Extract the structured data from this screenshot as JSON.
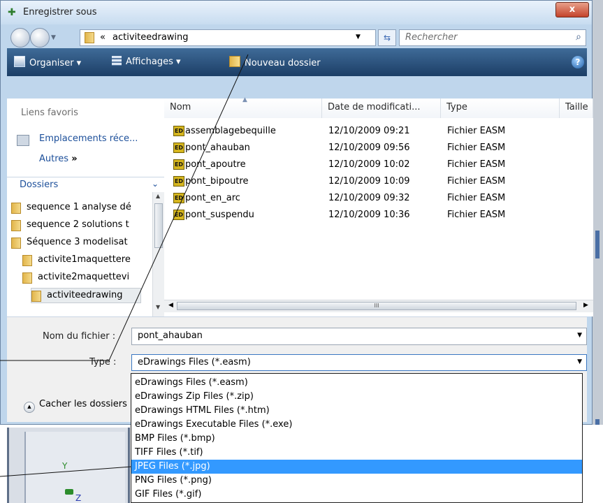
{
  "window": {
    "title": "Enregistrer sous",
    "close_label": "x"
  },
  "nav": {
    "breadcrumb_prefix": "«",
    "path": "activiteedrawing",
    "search_placeholder": "Rechercher"
  },
  "toolbar": {
    "organize": "Organiser",
    "views": "Affichages",
    "new_folder": "Nouveau dossier",
    "help": "?"
  },
  "sidebar": {
    "favorites_header": "Liens favoris",
    "recent_places": "Emplacements réce...",
    "others": "Autres",
    "others_chevron": "»",
    "folders_header": "Dossiers",
    "tree": [
      "sequence 1 analyse dé",
      "sequence 2 solutions t",
      "Séquence 3 modelisat",
      "activite1maquettere",
      "activite2maquettevi",
      "activiteedrawing"
    ]
  },
  "file_list": {
    "columns": [
      "Nom",
      "Date de modificati...",
      "Type",
      "Taille"
    ],
    "rows": [
      {
        "name": "assemblagebequille",
        "date": "12/10/2009 09:21",
        "type": "Fichier EASM"
      },
      {
        "name": "pont_ahauban",
        "date": "12/10/2009 09:56",
        "type": "Fichier EASM"
      },
      {
        "name": "pont_apoutre",
        "date": "12/10/2009 10:02",
        "type": "Fichier EASM"
      },
      {
        "name": "pont_bipoutre",
        "date": "12/10/2009 10:09",
        "type": "Fichier EASM"
      },
      {
        "name": "pont_en_arc",
        "date": "12/10/2009 09:32",
        "type": "Fichier EASM"
      },
      {
        "name": "pont_suspendu",
        "date": "12/10/2009 10:36",
        "type": "Fichier EASM"
      }
    ],
    "hscroll_grip": "III"
  },
  "form": {
    "filename_label": "Nom du fichier :",
    "filename_value": "pont_ahauban",
    "type_label": "Type :",
    "type_value": "eDrawings Files (*.easm)",
    "hide_folders_label": "Cacher les dossiers"
  },
  "type_options": [
    "eDrawings Files (*.easm)",
    "eDrawings Zip Files (*.zip)",
    "eDrawings HTML Files (*.htm)",
    "eDrawings Executable Files (*.exe)",
    "BMP Files (*.bmp)",
    "TIFF Files (*.tif)",
    "JPEG Files (*.jpg)",
    "PNG Files (*.png)",
    "GIF Files (*.gif)"
  ],
  "type_options_highlighted": "JPEG Files (*.jpg)",
  "background": {
    "axis_y": "Y",
    "axis_z": "Z"
  },
  "colors": {
    "toolbar": "#1c3e66",
    "highlight": "#3399ff",
    "link": "#1c4f9a"
  }
}
